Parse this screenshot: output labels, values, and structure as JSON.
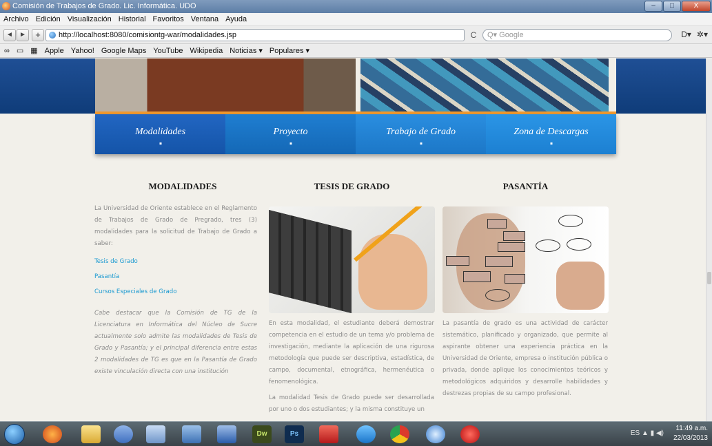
{
  "window": {
    "title": "Comisión de Trabajos de Grado. Lic. Informática. UDO",
    "buttons": [
      "–",
      "□",
      "X"
    ]
  },
  "menubar": [
    "Archivo",
    "Edición",
    "Visualización",
    "Historial",
    "Favoritos",
    "Ventana",
    "Ayuda"
  ],
  "navbar": {
    "back": "◄",
    "forward": "►",
    "add": "+",
    "url": "http://localhost:8080/comisiontg-war/modalidades.jsp",
    "reload": "C",
    "search_placeholder": "Q▾ Google",
    "tools": [
      "D▾",
      "✲▾"
    ]
  },
  "bookmarks": [
    "Apple",
    "Yahoo!",
    "Google Maps",
    "YouTube",
    "Wikipedia",
    "Noticias ▾",
    "Populares ▾"
  ],
  "bookmark_icons": [
    "∞",
    "▭",
    "▦"
  ],
  "site": {
    "menu": [
      "Modalidades",
      "Proyecto",
      "Trabajo de Grado",
      "Zona de Descargas"
    ],
    "col1": {
      "title": "MODALIDADES",
      "intro": "La Universidad de Oriente establece en el Reglamento de Trabajos de Grado de Pregrado, tres (3) modalidades para la solicitud de Trabajo de Grado a saber:",
      "links": [
        "Tesis de Grado",
        "Pasantía",
        "Cursos Especiales de Grado"
      ],
      "note": "Cabe destacar que la Comisión de TG de la Licenciatura en Informática del Núcleo de Sucre actualmente solo admite las modalidades de Tesis de Grado y Pasantía; y el principal diferencia entre estas 2 modalidades de TG es que en la Pasantía de Grado existe vinculación directa con una institución"
    },
    "col2": {
      "title": "TESIS DE GRADO",
      "p1": "En esta modalidad, el estudiante deberá demostrar competencia en el estudio de un tema y/o problema de investigación, mediante la aplicación de una rigurosa metodología que puede ser descriptiva, estadística, de campo, documental, etnográfica, hermenéutica o fenomenológica.",
      "p2": "La modalidad Tesis de Grado puede ser desarrollada por uno o dos estudiantes; y la misma constituye un"
    },
    "col3": {
      "title": "PASANTÍA",
      "p1": "La pasantía de grado es una actividad de carácter sistemático, planificado y organizado, que permite al aspirante obtener una experiencia práctica en la Universidad de Oriente, empresa o institución pública o privada, donde aplique los conocimientos teóricos y metodológicos adquiridos y desarrolle habilidades y destrezas propias de su campo profesional."
    }
  },
  "taskbar": {
    "apps": [
      "Firefox",
      "Explorer",
      "Network",
      "VirtualBox",
      "Database",
      "Word",
      "Dw",
      "Ps",
      "Acrobat",
      "Internet Explorer",
      "Chrome",
      "Safari",
      "Opera"
    ],
    "tray_lang": "ES",
    "time": "11:49 a.m.",
    "date": "22/03/2013"
  }
}
